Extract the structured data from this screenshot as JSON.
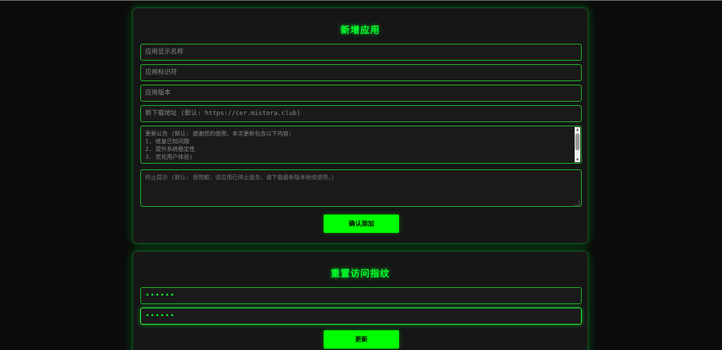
{
  "add_app": {
    "title": "新增应用",
    "display_name": {
      "placeholder": "应用显示名称",
      "value": ""
    },
    "identifier": {
      "placeholder": "应用标识符",
      "value": ""
    },
    "version": {
      "placeholder": "应用版本",
      "value": ""
    },
    "download_url": {
      "placeholder": "新下载地址 (默认: https://cer.mistora.club)",
      "value": ""
    },
    "update_notice": {
      "placeholder": "更新公告 (默认: 感谢您的使用，本次更新包含以下内容:\n1. 修复已知问题\n2. 提升系统稳定性\n3. 优化用户体验)"
    },
    "terminate_notice": {
      "placeholder": "终止提示 (默认: 很抱歉，该应用已停止服务，请下载最新版本继续使用。)"
    },
    "submit_label": "确认添加"
  },
  "reset_fingerprint": {
    "title": "重置访问指纹",
    "password1_mask": "••••••",
    "password2_mask": "••••••",
    "submit_label": "更新"
  },
  "colors": {
    "accent": "#00ff2a",
    "button": "#00ff00",
    "card_bg": "#161616",
    "page_bg": "#0b0b0b"
  }
}
